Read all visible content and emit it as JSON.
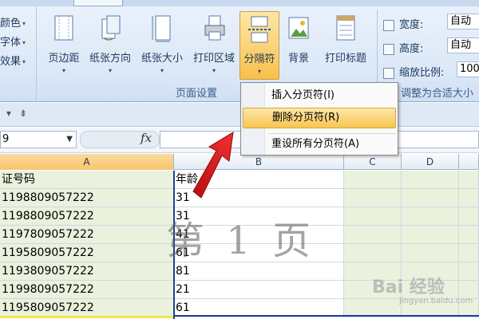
{
  "ribbon": {
    "tabs": [
      "",
      "",
      "",
      "",
      "",
      ""
    ],
    "left_group": [
      {
        "label": "颜色",
        "icon": "color-icon"
      },
      {
        "label": "字体",
        "icon": "font-icon"
      },
      {
        "label": "效果",
        "icon": "effect-icon"
      }
    ],
    "page_setup": {
      "margins": "页边距",
      "orientation": "纸张方向",
      "size": "纸张大小",
      "print_area": "打印区域",
      "breaks": "分隔符",
      "background": "背景",
      "print_titles": "打印标题",
      "group_label": "页面设置"
    },
    "scale_to_fit": {
      "width_label": "宽度:",
      "width_value": "自动",
      "height_label": "高度:",
      "height_value": "自动",
      "scale_label": "缩放比例:",
      "scale_value": "100",
      "group_label": "调整为合适大小"
    }
  },
  "breaks_menu": {
    "items": [
      {
        "label": "插入分页符(I)",
        "state": "normal"
      },
      {
        "label": "删除分页符(R)",
        "state": "hover"
      },
      {
        "label": "重设所有分页符(A)",
        "state": "normal"
      }
    ]
  },
  "formula_bar": {
    "name_box": "9",
    "fx": "fx"
  },
  "sheet": {
    "columns": [
      "A",
      "B",
      "C",
      "D"
    ],
    "header_row": {
      "a": "证号码",
      "b": "年龄"
    },
    "rows": [
      {
        "a": "1198809057222",
        "b": "31"
      },
      {
        "a": "1198809057222",
        "b": "31"
      },
      {
        "a": "1197809057222",
        "b": "41"
      },
      {
        "a": "1195809057222",
        "b": "61"
      },
      {
        "a": "1193809057222",
        "b": "81"
      },
      {
        "a": "1199809057222",
        "b": "21"
      },
      {
        "a": "1195809057222",
        "b": "61"
      }
    ],
    "page_watermark": "第 1 页"
  },
  "colors": {
    "accent_hover": "#f7c550",
    "page_break": "#1f3f9f",
    "arrow": "#e01a1a"
  },
  "watermark": {
    "brand": "Bai 经验",
    "url": "jingyan.baidu.com"
  }
}
